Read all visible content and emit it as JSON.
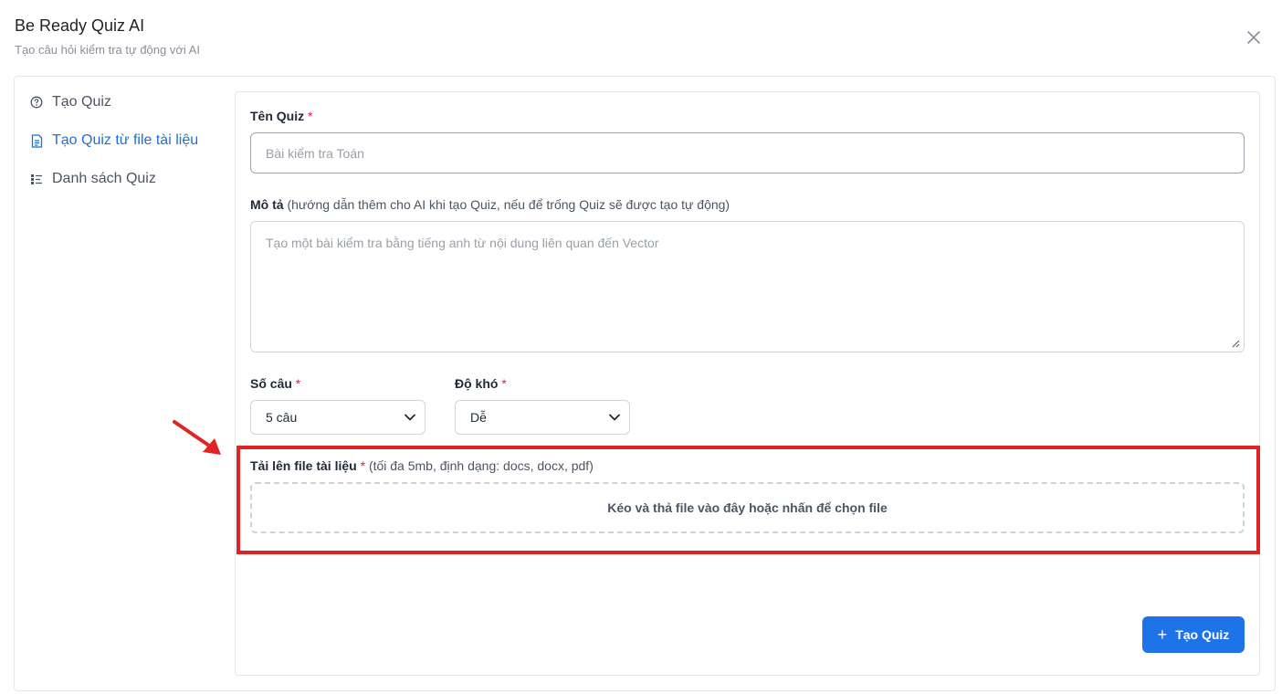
{
  "header": {
    "title": "Be Ready Quiz AI",
    "subtitle": "Tạo câu hỏi kiểm tra tự động với AI"
  },
  "sidebar": {
    "items": [
      {
        "label": "Tạo Quiz",
        "icon": "question-circle-icon",
        "active": false
      },
      {
        "label": "Tạo Quiz từ file tài liệu",
        "icon": "document-icon",
        "active": true
      },
      {
        "label": "Danh sách Quiz",
        "icon": "list-icon",
        "active": false
      }
    ]
  },
  "form": {
    "name": {
      "label": "Tên Quiz",
      "required_mark": "*",
      "placeholder": "Bài kiểm tra Toán"
    },
    "description": {
      "label": "Mô tả",
      "hint": "(hướng dẫn thêm cho AI khi tạo Quiz, nếu để trống Quiz sẽ được tạo tự động)",
      "placeholder": "Tạo một bài kiểm tra bằng tiếng anh từ nội dung liên quan đến Vector"
    },
    "count": {
      "label": "Số câu",
      "required_mark": "*",
      "value": "5 câu"
    },
    "difficulty": {
      "label": "Độ khó",
      "required_mark": "*",
      "value": "Dễ"
    },
    "upload": {
      "label": "Tải lên file tài liệu",
      "required_mark": "*",
      "hint": "(tối đa 5mb, định dạng: docs, docx, pdf)",
      "dropzone_text": "Kéo và thả file vào đây hoặc nhấn để chọn file"
    },
    "submit_label": "Tạo Quiz"
  },
  "colors": {
    "accent": "#1f73e8",
    "active_nav": "#1f6fd6",
    "annotation": "#e02424",
    "required": "#e11d48"
  }
}
